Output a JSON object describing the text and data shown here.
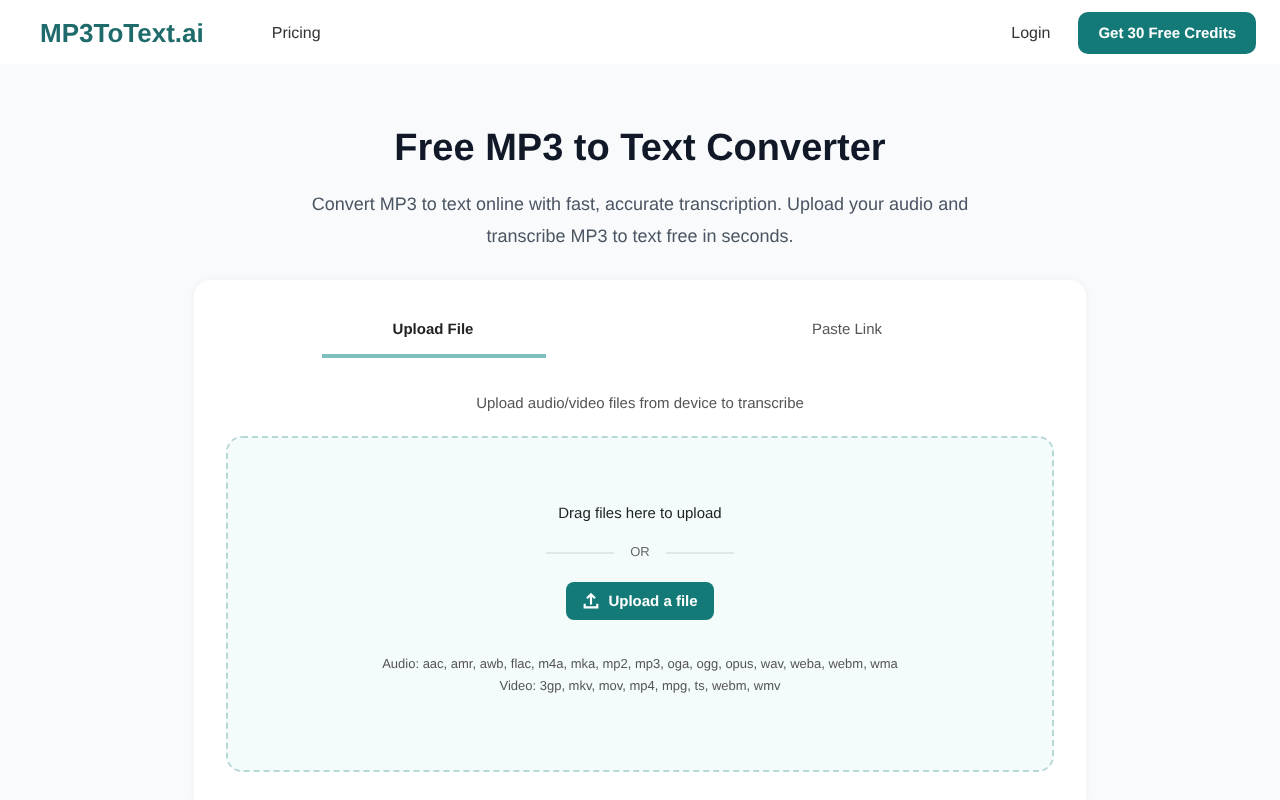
{
  "header": {
    "logo": "MP3ToText.ai",
    "nav": [
      "Pricing"
    ],
    "login": "Login",
    "cta": "Get 30 Free Credits"
  },
  "hero": {
    "title": "Free MP3 to Text Converter",
    "subtitle": "Convert MP3 to text online with fast, accurate transcription. Upload your audio and transcribe MP3 to text free in seconds."
  },
  "tabs": [
    {
      "label": "Upload File",
      "selected": true
    },
    {
      "label": "Paste Link",
      "selected": false
    }
  ],
  "upload": {
    "instruction": "Upload audio/video files from device to transcribe",
    "drop_text": "Drag files here to upload",
    "divider": "OR",
    "button": "Upload a file",
    "formats": [
      "Audio: aac, amr, awb, flac, m4a, mka, mp2, mp3, oga, ogg, opus, wav, weba, webm, wma",
      "Video: 3gp, mkv, mov, mp4, mpg, ts, webm, wmv"
    ]
  }
}
